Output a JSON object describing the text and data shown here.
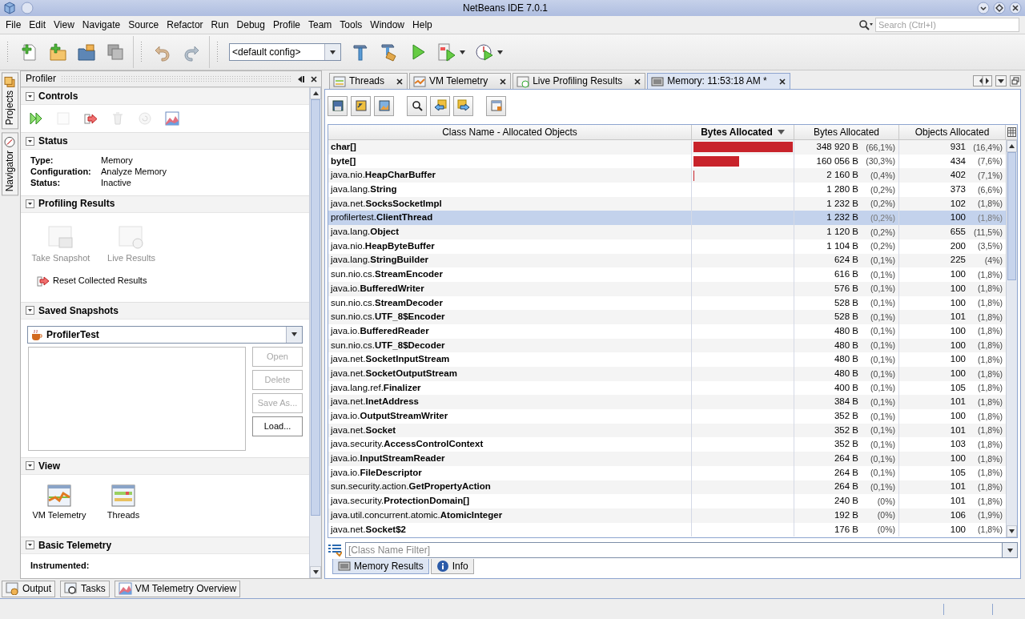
{
  "window": {
    "title": "NetBeans IDE 7.0.1"
  },
  "menu": [
    "File",
    "Edit",
    "View",
    "Navigate",
    "Source",
    "Refactor",
    "Run",
    "Debug",
    "Profile",
    "Team",
    "Tools",
    "Window",
    "Help"
  ],
  "search": {
    "placeholder": "Search (Ctrl+I)"
  },
  "toolbar": {
    "config": "<default config>"
  },
  "side_tabs": [
    {
      "label": "Projects"
    },
    {
      "label": "Navigator"
    }
  ],
  "profiler": {
    "title": "Profiler",
    "sections": [
      {
        "kind": "controls",
        "title": "Controls",
        "expanded": true,
        "buttons": [
          {
            "disabled": false
          },
          {
            "disabled": true
          },
          {
            "disabled": false
          },
          {
            "disabled": true
          },
          {
            "disabled": true
          },
          {
            "disabled": false
          }
        ]
      },
      {
        "kind": "status",
        "title": "Status",
        "expanded": true,
        "fields": [
          {
            "label": "Type:",
            "value": "Memory"
          },
          {
            "label": "Configuration:",
            "value": "Analyze Memory"
          },
          {
            "label": "Status:",
            "value": "Inactive"
          }
        ]
      },
      {
        "kind": "results",
        "title": "Profiling Results",
        "expanded": true,
        "actions": [
          {
            "label": "Take Snapshot",
            "disabled": true
          },
          {
            "label": "Live Results",
            "disabled": true
          }
        ],
        "link": "Reset Collected Results"
      },
      {
        "kind": "snapshots",
        "title": "Saved Snapshots",
        "expanded": true,
        "project": "ProfilerTest",
        "buttons": [
          {
            "label": "Open",
            "disabled": true
          },
          {
            "label": "Delete",
            "disabled": true
          },
          {
            "label": "Save As...",
            "disabled": true
          },
          {
            "label": "Load...",
            "disabled": false
          }
        ]
      },
      {
        "kind": "view",
        "title": "View",
        "expanded": true,
        "items": [
          {
            "label": "VM Telemetry"
          },
          {
            "label": "Threads"
          }
        ]
      },
      {
        "kind": "telemetry",
        "title": "Basic Telemetry",
        "expanded": true,
        "fields": [
          {
            "label": "Instrumented:"
          }
        ]
      }
    ]
  },
  "editor_tabs": [
    {
      "label": "Threads",
      "selected": false
    },
    {
      "label": "VM Telemetry",
      "selected": false
    },
    {
      "label": "Live Profiling Results",
      "selected": false
    },
    {
      "label": "Memory: 11:53:18 AM *",
      "selected": true
    }
  ],
  "table": {
    "columns": [
      {
        "label": "Class Name - Allocated Objects",
        "sorted": false
      },
      {
        "label": "Bytes Allocated",
        "sorted": true
      },
      {
        "label": "Bytes Allocated",
        "sorted": false
      },
      {
        "label": "Objects Allocated",
        "sorted": false
      }
    ],
    "rows": [
      {
        "class_name": "char[]",
        "bytes": "348 920 B",
        "bytes_pct": "(66,1%)",
        "objects": "931",
        "objects_pct": "(16,4%)",
        "level": 1,
        "selected": false
      },
      {
        "class_name": "byte[]",
        "bytes": "160 056 B",
        "bytes_pct": "(30,3%)",
        "objects": "434",
        "objects_pct": "(7,6%)",
        "level": 0.459,
        "selected": false
      },
      {
        "package": "java.nio.",
        "class_name": "HeapCharBuffer",
        "bytes": "2 160 B",
        "bytes_pct": "(0,4%)",
        "objects": "402",
        "objects_pct": "(7,1%)",
        "level": 0.006,
        "selected": false
      },
      {
        "package": "java.lang.",
        "class_name": "String",
        "bytes": "1 280 B",
        "bytes_pct": "(0,2%)",
        "objects": "373",
        "objects_pct": "(6,6%)",
        "selected": false
      },
      {
        "package": "java.net.",
        "class_name": "SocksSocketImpl",
        "bytes": "1 232 B",
        "bytes_pct": "(0,2%)",
        "objects": "102",
        "objects_pct": "(1,8%)",
        "selected": false
      },
      {
        "package": "profilertest.",
        "class_name": "ClientThread",
        "bytes": "1 232 B",
        "bytes_pct": "(0,2%)",
        "objects": "100",
        "objects_pct": "(1,8%)",
        "selected": true
      },
      {
        "package": "java.lang.",
        "class_name": "Object",
        "bytes": "1 120 B",
        "bytes_pct": "(0,2%)",
        "objects": "655",
        "objects_pct": "(11,5%)",
        "selected": false
      },
      {
        "package": "java.nio.",
        "class_name": "HeapByteBuffer",
        "bytes": "1 104 B",
        "bytes_pct": "(0,2%)",
        "objects": "200",
        "objects_pct": "(3,5%)",
        "selected": false
      },
      {
        "package": "java.lang.",
        "class_name": "StringBuilder",
        "bytes": "624 B",
        "bytes_pct": "(0,1%)",
        "objects": "225",
        "objects_pct": "(4%)",
        "selected": false
      },
      {
        "package": "sun.nio.cs.",
        "class_name": "StreamEncoder",
        "bytes": "616 B",
        "bytes_pct": "(0,1%)",
        "objects": "100",
        "objects_pct": "(1,8%)",
        "selected": false
      },
      {
        "package": "java.io.",
        "class_name": "BufferedWriter",
        "bytes": "576 B",
        "bytes_pct": "(0,1%)",
        "objects": "100",
        "objects_pct": "(1,8%)",
        "selected": false
      },
      {
        "package": "sun.nio.cs.",
        "class_name": "StreamDecoder",
        "bytes": "528 B",
        "bytes_pct": "(0,1%)",
        "objects": "100",
        "objects_pct": "(1,8%)",
        "selected": false
      },
      {
        "package": "sun.nio.cs.",
        "class_name": "UTF_8$Encoder",
        "bytes": "528 B",
        "bytes_pct": "(0,1%)",
        "objects": "101",
        "objects_pct": "(1,8%)",
        "selected": false
      },
      {
        "package": "java.io.",
        "class_name": "BufferedReader",
        "bytes": "480 B",
        "bytes_pct": "(0,1%)",
        "objects": "100",
        "objects_pct": "(1,8%)",
        "selected": false
      },
      {
        "package": "sun.nio.cs.",
        "class_name": "UTF_8$Decoder",
        "bytes": "480 B",
        "bytes_pct": "(0,1%)",
        "objects": "100",
        "objects_pct": "(1,8%)",
        "selected": false
      },
      {
        "package": "java.net.",
        "class_name": "SocketInputStream",
        "bytes": "480 B",
        "bytes_pct": "(0,1%)",
        "objects": "100",
        "objects_pct": "(1,8%)",
        "selected": false
      },
      {
        "package": "java.net.",
        "class_name": "SocketOutputStream",
        "bytes": "480 B",
        "bytes_pct": "(0,1%)",
        "objects": "100",
        "objects_pct": "(1,8%)",
        "selected": false
      },
      {
        "package": "java.lang.ref.",
        "class_name": "Finalizer",
        "bytes": "400 B",
        "bytes_pct": "(0,1%)",
        "objects": "105",
        "objects_pct": "(1,8%)",
        "selected": false
      },
      {
        "package": "java.net.",
        "class_name": "InetAddress",
        "bytes": "384 B",
        "bytes_pct": "(0,1%)",
        "objects": "101",
        "objects_pct": "(1,8%)",
        "selected": false
      },
      {
        "package": "java.io.",
        "class_name": "OutputStreamWriter",
        "bytes": "352 B",
        "bytes_pct": "(0,1%)",
        "objects": "100",
        "objects_pct": "(1,8%)",
        "selected": false
      },
      {
        "package": "java.net.",
        "class_name": "Socket",
        "bytes": "352 B",
        "bytes_pct": "(0,1%)",
        "objects": "101",
        "objects_pct": "(1,8%)",
        "selected": false
      },
      {
        "package": "java.security.",
        "class_name": "AccessControlContext",
        "bytes": "352 B",
        "bytes_pct": "(0,1%)",
        "objects": "103",
        "objects_pct": "(1,8%)",
        "selected": false
      },
      {
        "package": "java.io.",
        "class_name": "InputStreamReader",
        "bytes": "264 B",
        "bytes_pct": "(0,1%)",
        "objects": "100",
        "objects_pct": "(1,8%)",
        "selected": false
      },
      {
        "package": "java.io.",
        "class_name": "FileDescriptor",
        "bytes": "264 B",
        "bytes_pct": "(0,1%)",
        "objects": "105",
        "objects_pct": "(1,8%)",
        "selected": false
      },
      {
        "package": "sun.security.action.",
        "class_name": "GetPropertyAction",
        "bytes": "264 B",
        "bytes_pct": "(0,1%)",
        "objects": "101",
        "objects_pct": "(1,8%)",
        "selected": false
      },
      {
        "package": "java.security.",
        "class_name": "ProtectionDomain[]",
        "bytes": "240 B",
        "bytes_pct": "(0%)",
        "objects": "101",
        "objects_pct": "(1,8%)",
        "selected": false
      },
      {
        "package": "java.util.concurrent.atomic.",
        "class_name": "AtomicInteger",
        "bytes": "192 B",
        "bytes_pct": "(0%)",
        "objects": "106",
        "objects_pct": "(1,9%)",
        "selected": false
      },
      {
        "package": "java.net.",
        "class_name": "Socket$2",
        "bytes": "176 B",
        "bytes_pct": "(0%)",
        "objects": "100",
        "objects_pct": "(1,8%)",
        "selected": false
      }
    ]
  },
  "filter": {
    "placeholder": "[Class Name Filter]"
  },
  "result_tabs": [
    {
      "label": "Memory Results",
      "selected": true
    },
    {
      "label": "Info",
      "selected": false
    }
  ],
  "taskbar": [
    "Output",
    "Tasks",
    "VM Telemetry Overview"
  ]
}
